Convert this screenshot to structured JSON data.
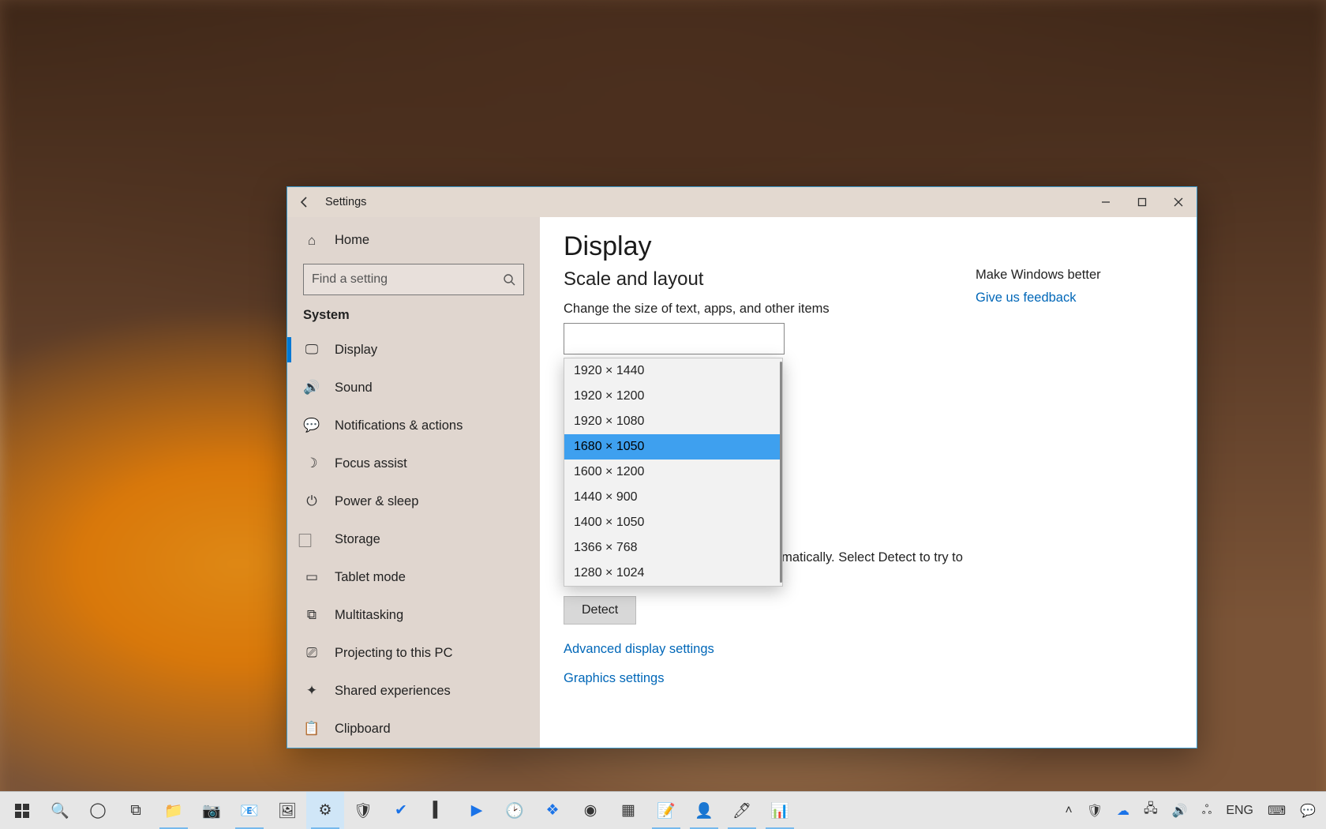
{
  "window": {
    "title": "Settings",
    "home_label": "Home",
    "search_placeholder": "Find a setting",
    "section_label": "System"
  },
  "sidebar": {
    "items": [
      {
        "label": "Display",
        "icon": "🖵",
        "selected": true
      },
      {
        "label": "Sound",
        "icon": "🔊"
      },
      {
        "label": "Notifications & actions",
        "icon": "💬"
      },
      {
        "label": "Focus assist",
        "icon": "☽"
      },
      {
        "label": "Power & sleep",
        "icon": "⏻"
      },
      {
        "label": "Storage",
        "icon": "⃞"
      },
      {
        "label": "Tablet mode",
        "icon": "▭"
      },
      {
        "label": "Multitasking",
        "icon": "⧉"
      },
      {
        "label": "Projecting to this PC",
        "icon": "⎚"
      },
      {
        "label": "Shared experiences",
        "icon": "✦"
      },
      {
        "label": "Clipboard",
        "icon": "📋"
      }
    ]
  },
  "content": {
    "page_title": "Display",
    "section_title": "Scale and layout",
    "scale_label": "Change the size of text, apps, and other items",
    "multi_text": "utomatically. Select Detect to try to connect to them.",
    "multi_text_prefix": "",
    "detect_button": "Detect",
    "adv_link": "Advanced display settings",
    "gfx_link": "Graphics settings"
  },
  "help": {
    "title": "Make Windows better",
    "feedback": "Give us feedback"
  },
  "dropdown": {
    "items": [
      "1920 × 1440",
      "1920 × 1200",
      "1920 × 1080",
      "1680 × 1050",
      "1600 × 1200",
      "1440 × 900",
      "1400 × 1050",
      "1366 × 768",
      "1280 × 1024"
    ],
    "selected_index": 3
  },
  "taskbar": {
    "lang": "ENG"
  }
}
